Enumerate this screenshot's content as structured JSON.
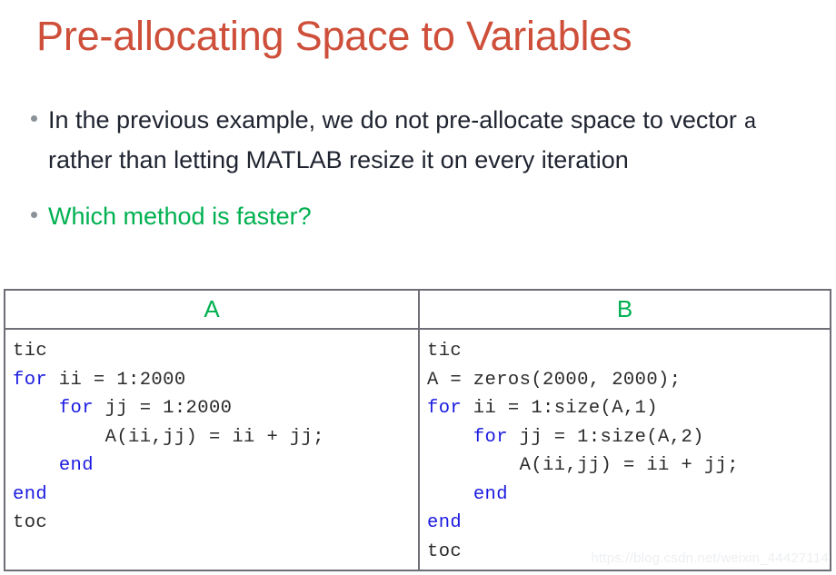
{
  "slide": {
    "title": "Pre-allocating Space to Variables",
    "title_color": "#CE4F3A",
    "accent_green": "#00B050",
    "keyword_blue": "#1A1AE0",
    "body_color": "#1F2430",
    "border_color": "#6E6E76"
  },
  "bullets": [
    {
      "text_before": "In the previous example, we do not pre-allocate space to vector ",
      "mono_token": "a",
      "text_after": " rather than letting MATLAB resize it on every iteration",
      "color": "#1F2430"
    },
    {
      "text": "Which method is faster?",
      "color": "#00B050"
    }
  ],
  "table": {
    "columns": [
      {
        "header": "A",
        "code_lines": [
          {
            "indent": 0,
            "parts": [
              {
                "t": "tic",
                "kw": false
              }
            ]
          },
          {
            "indent": 0,
            "parts": [
              {
                "t": "for",
                "kw": true
              },
              {
                "t": " ii = 1:2000",
                "kw": false
              }
            ]
          },
          {
            "indent": 4,
            "parts": [
              {
                "t": "for",
                "kw": true
              },
              {
                "t": " jj = 1:2000",
                "kw": false
              }
            ]
          },
          {
            "indent": 8,
            "parts": [
              {
                "t": "A(ii,jj) = ii + jj;",
                "kw": false
              }
            ]
          },
          {
            "indent": 4,
            "parts": [
              {
                "t": "end",
                "kw": true
              }
            ]
          },
          {
            "indent": 0,
            "parts": [
              {
                "t": "end",
                "kw": true
              }
            ]
          },
          {
            "indent": 0,
            "parts": [
              {
                "t": "toc",
                "kw": false
              }
            ]
          }
        ]
      },
      {
        "header": "B",
        "code_lines": [
          {
            "indent": 0,
            "parts": [
              {
                "t": "tic",
                "kw": false
              }
            ]
          },
          {
            "indent": 0,
            "parts": [
              {
                "t": "A = zeros(2000, 2000);",
                "kw": false
              }
            ]
          },
          {
            "indent": 0,
            "parts": [
              {
                "t": "for",
                "kw": true
              },
              {
                "t": " ii = 1:size(A,1)",
                "kw": false
              }
            ]
          },
          {
            "indent": 4,
            "parts": [
              {
                "t": "for",
                "kw": true
              },
              {
                "t": " jj = 1:size(A,2)",
                "kw": false
              }
            ]
          },
          {
            "indent": 8,
            "parts": [
              {
                "t": "A(ii,jj) = ii + jj;",
                "kw": false
              }
            ]
          },
          {
            "indent": 4,
            "parts": [
              {
                "t": "end",
                "kw": true
              }
            ]
          },
          {
            "indent": 0,
            "parts": [
              {
                "t": "end",
                "kw": true
              }
            ]
          },
          {
            "indent": 0,
            "parts": [
              {
                "t": "toc",
                "kw": false
              }
            ]
          }
        ]
      }
    ]
  },
  "watermark": {
    "text": "https://blog.csdn.net/weixin_44427114"
  }
}
